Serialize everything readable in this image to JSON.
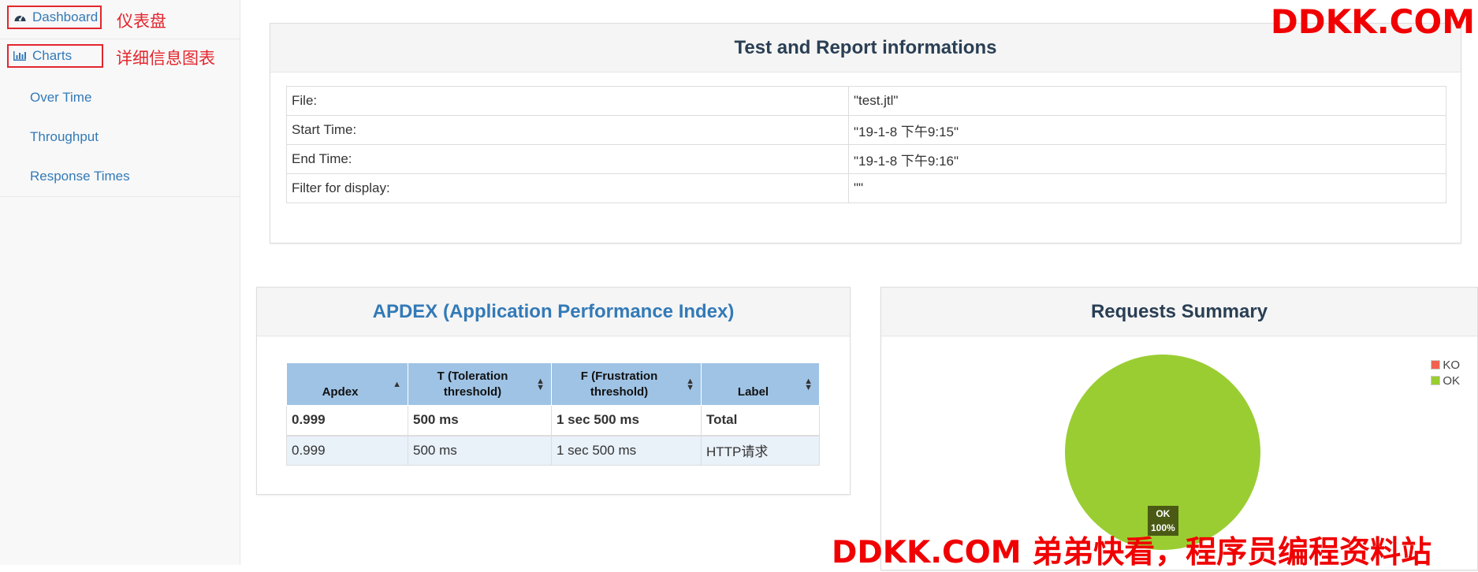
{
  "sidebar": {
    "dashboard_label": "Dashboard",
    "charts_label": "Charts",
    "dashboard_annotation": "仪表盘",
    "charts_annotation": "详细信息图表",
    "sub_items": [
      {
        "label": "Over Time"
      },
      {
        "label": "Throughput"
      },
      {
        "label": "Response Times"
      }
    ]
  },
  "test_info": {
    "title": "Test and Report informations",
    "rows": [
      {
        "key": "File:",
        "value": "\"test.jtl\""
      },
      {
        "key": "Start Time:",
        "value": "\"19-1-8 下午9:15\""
      },
      {
        "key": "End Time:",
        "value": "\"19-1-8 下午9:16\""
      },
      {
        "key": "Filter for display:",
        "value": "\"\""
      }
    ]
  },
  "apdex": {
    "title": "APDEX (Application Performance Index)",
    "columns": [
      "Apdex",
      "T (Toleration threshold)",
      "F (Frustration threshold)",
      "Label"
    ],
    "rows": [
      {
        "apdex": "0.999",
        "t": "500 ms",
        "f": "1 sec 500 ms",
        "label": "Total"
      },
      {
        "apdex": "0.999",
        "t": "500 ms",
        "f": "1 sec 500 ms",
        "label": "HTTP请求"
      }
    ]
  },
  "requests_summary": {
    "title": "Requests Summary",
    "legend": [
      {
        "label": "KO",
        "color": "#f0624f"
      },
      {
        "label": "OK",
        "color": "#9acd32"
      }
    ],
    "slice_label": "OK",
    "slice_percent": "100%"
  },
  "chart_data": {
    "type": "pie",
    "title": "Requests Summary",
    "categories": [
      "KO",
      "OK"
    ],
    "values": [
      0,
      100
    ],
    "colors": [
      "#f0624f",
      "#9acd32"
    ],
    "legend": "top-right"
  },
  "watermarks": {
    "top": "DDKK.COM",
    "bottom": "DDKK.COM 弟弟快看，程序员编程资料站"
  }
}
